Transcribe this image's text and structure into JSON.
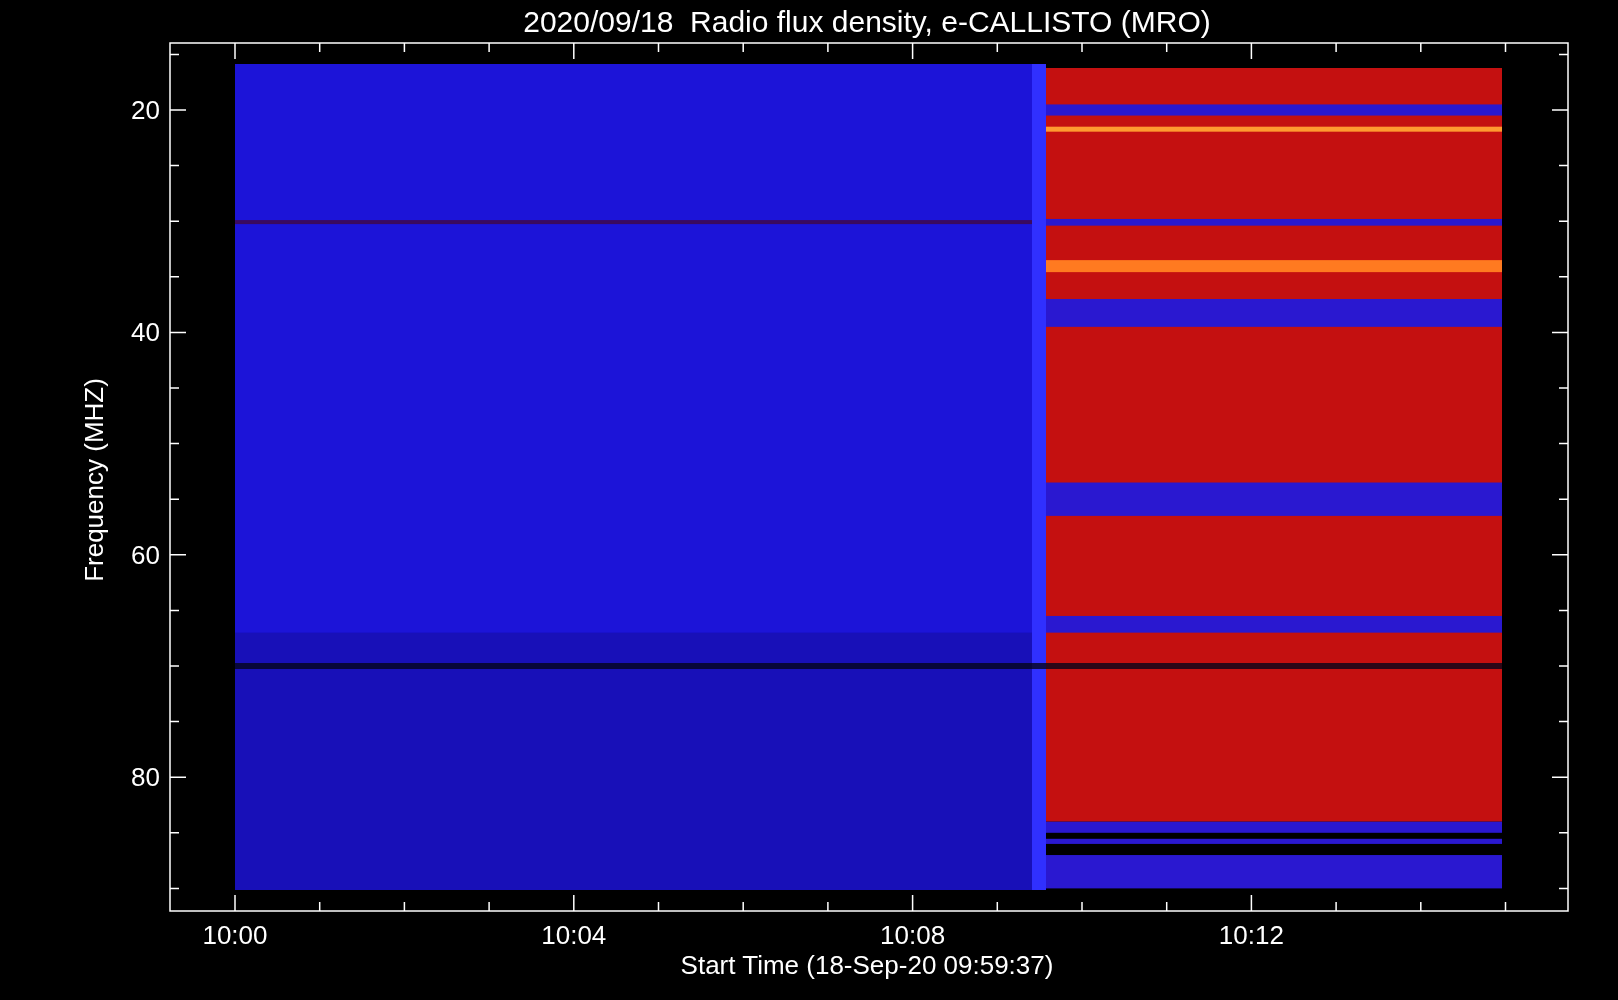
{
  "title": "2020/09/18  Radio flux density, e-CALLISTO (MRO)",
  "y_axis": {
    "label": "Frequency (MHZ)",
    "ticks": [
      "20",
      "40",
      "60",
      "80"
    ]
  },
  "x_axis": {
    "label": "Start Time (18-Sep-20 09:59:37)",
    "ticks": [
      "10:00",
      "10:04",
      "10:08",
      "10:12"
    ]
  }
}
